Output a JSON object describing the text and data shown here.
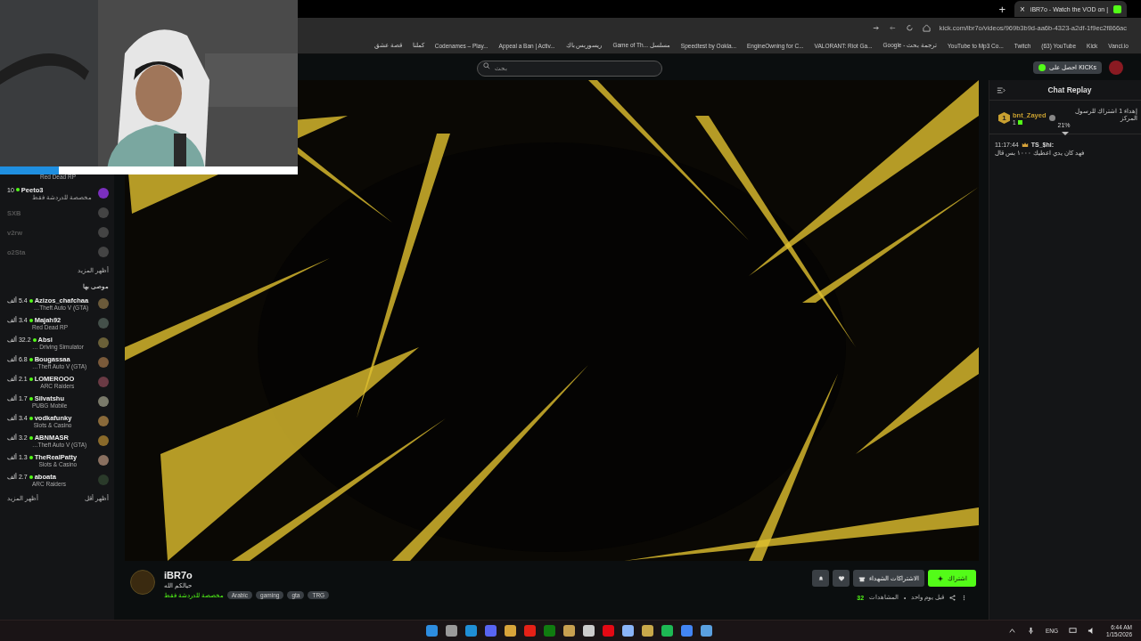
{
  "browser": {
    "new_tab": "+",
    "tab": {
      "title": "iBR7o - Watch the VOD on |",
      "close": "×",
      "selected": true
    },
    "url": "kick.com/ibr7o/videos/969b3b9d-aa6b-4323-a2df-1f9ec2f866ac",
    "bookmarks": [
      "Vanci.io",
      "Kick",
      "(63) YouTube",
      "Twitch",
      "YouTube to Mp3 Co...",
      "Google - ترجمة بحث",
      "VALORANT: Riot Ga...",
      "EngineOwning for C...",
      "Speedtest by Ookla...",
      "Game of Th... مسلسل",
      "ريسوربس باك",
      "Appeal a Ban | Activ...",
      "Codenames – Play...",
      "كملنا",
      "قصة عشق"
    ]
  },
  "header": {
    "search": {
      "placeholder": "بحث"
    },
    "kicks_button": "احصل على KICKs"
  },
  "sidebar": {
    "top_subtitle": "Red Dead RP",
    "following": [
      {
        "name": "Peeto3",
        "count": "10",
        "subtitle": "مخصصة للدردشة فقط",
        "live": true
      },
      {
        "name": "SXB",
        "live": false
      },
      {
        "name": "v2rw",
        "live": false
      },
      {
        "name": "o2Sta",
        "live": false
      }
    ],
    "show_more": "أظهر المزيد",
    "recommended_title": "موصى بها",
    "recommended": [
      {
        "name": "Azizos_chafchaa",
        "count": "5.4 ألف",
        "subtitle": "…Theft Auto V (GTA)",
        "live": true
      },
      {
        "name": "Majah92",
        "count": "3.4 ألف",
        "subtitle": "Red Dead RP",
        "live": true
      },
      {
        "name": "Absi",
        "count": "32.2 ألف",
        "subtitle": "… Driving Simulator",
        "live": true
      },
      {
        "name": "Bougassaa",
        "count": "6.8 ألف",
        "subtitle": "…Theft Auto V (GTA)",
        "live": true
      },
      {
        "name": "LOMEROOO",
        "count": "2.1 ألف",
        "subtitle": "ARC Raiders",
        "live": true
      },
      {
        "name": "Silvatshu",
        "count": "1.7 ألف",
        "subtitle": "PUBG Mobile",
        "live": true
      },
      {
        "name": "vodkafunky",
        "count": "3.4 ألف",
        "subtitle": "Slots & Casino",
        "live": true
      },
      {
        "name": "ABNMASR",
        "count": "3.2 ألف",
        "subtitle": "…Theft Auto V (GTA)",
        "live": true
      },
      {
        "name": "TheRealPatty",
        "count": "1.3 ألف",
        "subtitle": "Slots & Casino",
        "live": true
      },
      {
        "name": "aboata",
        "count": "2.7 ألف",
        "subtitle": "ARC Raiders",
        "live": true
      }
    ],
    "show_more_2": "أظهر المزيد",
    "show_less": "أظهر أقل"
  },
  "chat": {
    "title": "Chat Replay",
    "pinned": {
      "rank": "1",
      "user": "bnt_Zayed",
      "count": "1",
      "text": "إهداء 1 اشتراك للرسول المركز",
      "percent": "21%"
    },
    "messages": [
      {
        "time": "11:17:44",
        "user": "TS_$hi:",
        "text": "فهد كان يدي اعطيك ١٠٠٠ بس قال"
      }
    ]
  },
  "channel": {
    "name": "iBR7o",
    "bio": "حيالكم الله",
    "category": "مخصصة للدردشة فقط",
    "tags": [
      "TRG",
      "gta",
      "gaming",
      "Arabic"
    ],
    "gift_button": "الاشتراكات الشهداء",
    "subscribe_button": "اشتراك",
    "views_label": "المشاهدات",
    "separator": "•",
    "views": "32",
    "age": "قبل يوم واحد"
  },
  "taskbar": {
    "language": "ENG",
    "time": "6:44 AM",
    "date": "1/15/2026"
  }
}
